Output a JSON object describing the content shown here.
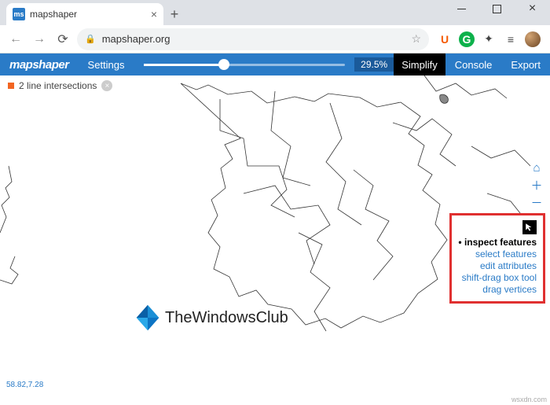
{
  "window": {
    "tab_title": "mapshaper",
    "favicon_text": "ms"
  },
  "browser": {
    "url": "mapshaper.org",
    "ext_u": "U",
    "ext_g": "G"
  },
  "app": {
    "logo": "mapshaper",
    "settings": "Settings",
    "percent": "29.5%",
    "simplify": "Simplify",
    "console": "Console",
    "export": "Export"
  },
  "status": {
    "text": "2 line intersections",
    "clear": "×"
  },
  "ctx": {
    "items": [
      {
        "label": "inspect features",
        "active": true
      },
      {
        "label": "select features",
        "active": false
      },
      {
        "label": "edit attributes",
        "active": false
      },
      {
        "label": "shift-drag box tool",
        "active": false
      },
      {
        "label": "drag vertices",
        "active": false
      }
    ]
  },
  "watermark": {
    "text": "TheWindowsClub"
  },
  "coords": "58.82,7.28",
  "source": "wsxdn.com",
  "chart_data": {
    "type": "map",
    "description": "Vector outline map (Africa/Europe region) loaded in mapshaper with simplification applied",
    "simplify_percent": 29.5,
    "line_intersections": 2,
    "cursor_coords": [
      58.82,
      7.28
    ]
  }
}
